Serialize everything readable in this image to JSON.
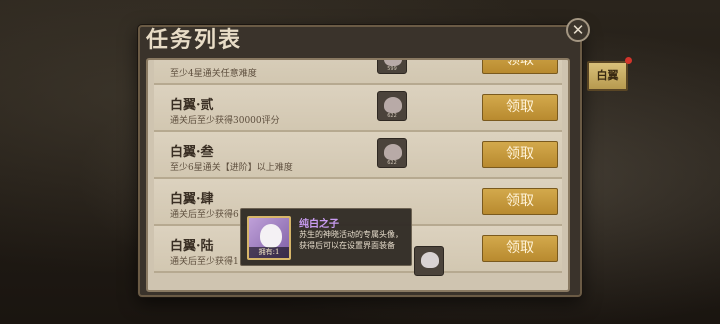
{
  "panel": {
    "title": "任务列表"
  },
  "side_tab": {
    "label": "白翼"
  },
  "tasks": [
    {
      "title": "",
      "desc": "至少4星通关任意难度",
      "reward_count": "599",
      "button": "领取"
    },
    {
      "title": "白翼·贰",
      "desc": "通关后至少获得30000评分",
      "reward_count": "622",
      "button": "领取"
    },
    {
      "title": "白翼·叁",
      "desc": "至少6星通关【进阶】以上难度",
      "reward_count": "622",
      "button": "领取"
    },
    {
      "title": "白翼·肆",
      "desc": "通关后至少获得6",
      "reward_count": "",
      "button": "领取"
    },
    {
      "title": "白翼·陆",
      "desc": "通关后至少获得1",
      "reward_count": "1",
      "button": "领取"
    }
  ],
  "tooltip": {
    "name": "纯白之子",
    "description": "苏生的神晓活动的专属头像，获得后可以在设置界面装备",
    "owned": "拥有:1"
  },
  "icons": {
    "close": "close-icon",
    "reward": "avatar-reward-icon"
  }
}
